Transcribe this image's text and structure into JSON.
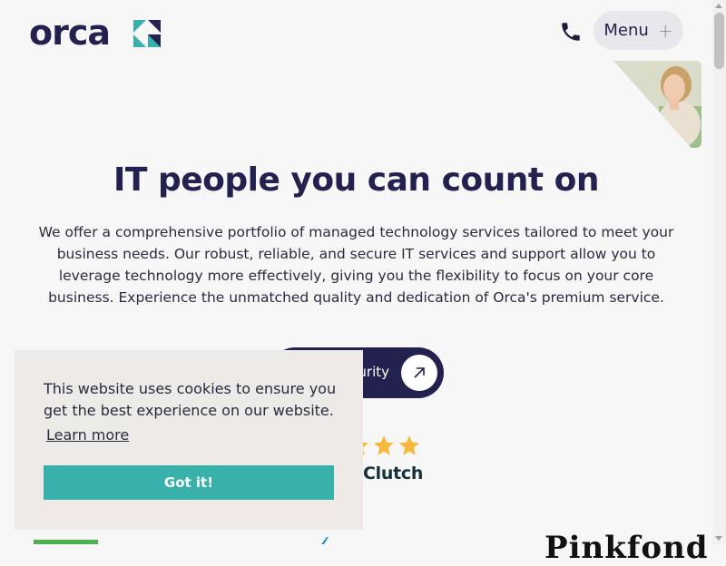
{
  "header": {
    "logo_text": "orca",
    "phone_icon": "phone-icon",
    "menu_label": "Menu",
    "menu_icon": "plus-icon"
  },
  "hero": {
    "title": "IT people you can count on",
    "description": "We offer a comprehensive portfolio of managed technology services tailored to meet your business needs. Our robust, reliable, and secure IT services and support allow you to leverage technology more effectively, giving you the flexibility to focus on your core business. Experience the unmatched quality and dedication of Orca's premium service.",
    "cta_label": "urity",
    "cta_icon": "arrow-up-right-icon"
  },
  "rating": {
    "stars": 5,
    "source": "Clutch"
  },
  "partners": {
    "serif_logo_text": "Pinkfond"
  },
  "cookie": {
    "message": "This website uses cookies to ensure you get the best experience on our website.",
    "learn_more": "Learn more",
    "accept": "Got it!"
  },
  "colors": {
    "brand_navy": "#23214f",
    "brand_teal": "#37b1aa",
    "star_yellow": "#f6b93b",
    "background": "#f7f7f8"
  }
}
